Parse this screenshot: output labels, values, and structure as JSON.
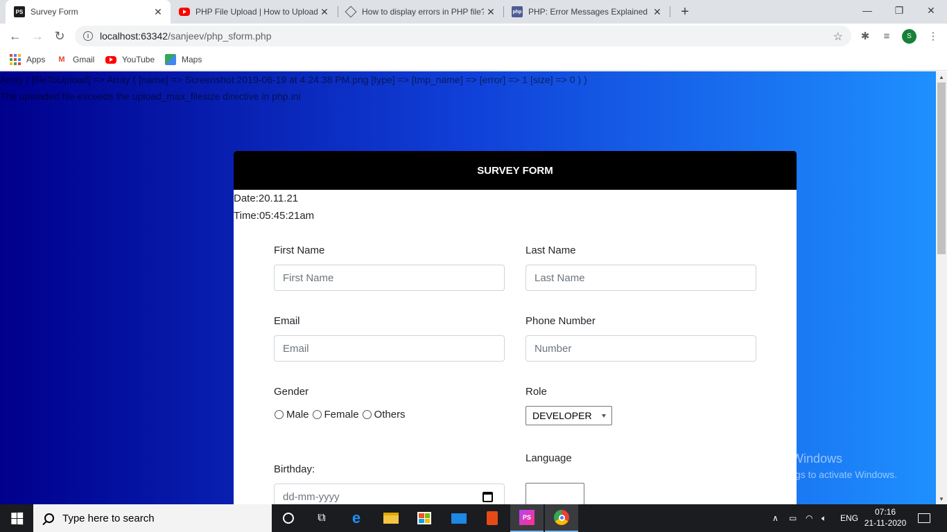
{
  "browser": {
    "tabs": [
      {
        "title": "Survey Form",
        "favicon": "phpstorm-icon",
        "active": true
      },
      {
        "title": "PHP File Upload | How to Upload",
        "favicon": "youtube-icon",
        "active": false
      },
      {
        "title": "How to display errors in PHP file?",
        "favicon": "diamond-icon",
        "active": false
      },
      {
        "title": "PHP: Error Messages Explained -",
        "favicon": "php-icon",
        "active": false
      }
    ],
    "url_host": "localhost:63342",
    "url_path": "/sanjeev/php_sform.php",
    "profile_initial": "S",
    "bookmarks": [
      {
        "label": "Apps",
        "icon": "apps-grid-icon"
      },
      {
        "label": "Gmail",
        "icon": "gmail-icon"
      },
      {
        "label": "YouTube",
        "icon": "youtube-icon"
      },
      {
        "label": "Maps",
        "icon": "maps-icon"
      }
    ]
  },
  "page": {
    "debug_output": "Array ( [fileToUpload] => Array ( [name] => Screenshot 2019-06-19 at 4.24.38 PM.png [type] => [tmp_name] => [error] => 1 [size] => 0 ) )",
    "error_message": "The uploaded file exceeds the upload_max_filesize directive in php.ini",
    "form": {
      "header": "SURVEY FORM",
      "date_line": "Date:20.11.21",
      "time_line": "Time:05:45:21am",
      "first_name": {
        "label": "First Name",
        "placeholder": "First Name",
        "value": ""
      },
      "last_name": {
        "label": "Last Name",
        "placeholder": "Last Name",
        "value": ""
      },
      "email": {
        "label": "Email",
        "placeholder": "Email",
        "value": ""
      },
      "phone": {
        "label": "Phone Number",
        "placeholder": "Number",
        "value": ""
      },
      "gender": {
        "label": "Gender",
        "options": [
          "Male",
          "Female",
          "Others"
        ]
      },
      "role": {
        "label": "Role",
        "selected": "DEVELOPER"
      },
      "birthday": {
        "label": "Birthday:",
        "placeholder": "dd-mm-yyyy"
      },
      "language": {
        "label": "Language"
      }
    }
  },
  "watermark": {
    "title": "Activate Windows",
    "subtitle": "Go to Settings to activate Windows."
  },
  "taskbar": {
    "search_placeholder": "Type here to search",
    "language": "ENG",
    "time": "07:16",
    "date": "21-11-2020",
    "accent_color": "#76b9ed"
  }
}
